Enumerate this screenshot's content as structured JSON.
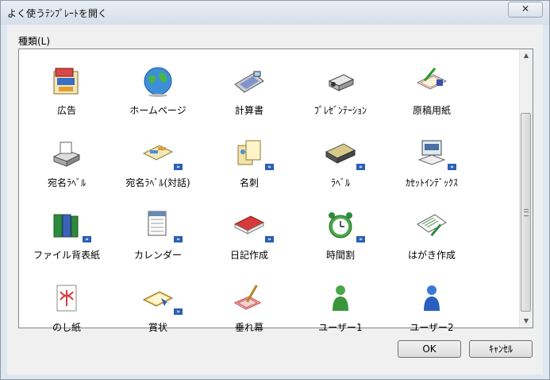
{
  "window": {
    "title": "よく使うﾃﾝﾌﾟﾚｰﾄを開く",
    "close_label": "✕"
  },
  "group": {
    "label": "種類(L)"
  },
  "items": [
    {
      "label": "広告",
      "icon": "sale-sign-icon"
    },
    {
      "label": "ホームページ",
      "icon": "globe-icon"
    },
    {
      "label": "計算書",
      "icon": "calculator-icon"
    },
    {
      "label": "ﾌﾟﾚｾﾞﾝﾃｰｼｮﾝ",
      "icon": "projector-icon"
    },
    {
      "label": "原稿用紙",
      "icon": "manuscript-paper-icon"
    },
    {
      "label": "宛名ﾗﾍﾞﾙ",
      "icon": "printer-label-icon"
    },
    {
      "label": "宛名ﾗﾍﾞﾙ(対話)",
      "icon": "interactive-label-icon"
    },
    {
      "label": "名刺",
      "icon": "business-card-icon"
    },
    {
      "label": "ﾗﾍﾞﾙ",
      "icon": "label-sheet-icon"
    },
    {
      "label": "ｶｾｯﾄｲﾝﾃﾞｯｸｽ",
      "icon": "cassette-index-icon"
    },
    {
      "label": "ファイル背表紙",
      "icon": "file-binder-icon"
    },
    {
      "label": "カレンダー",
      "icon": "calendar-icon"
    },
    {
      "label": "日記作成",
      "icon": "diary-icon"
    },
    {
      "label": "時間割",
      "icon": "alarm-clock-icon"
    },
    {
      "label": "はがき作成",
      "icon": "postcard-icon"
    },
    {
      "label": "のし紙",
      "icon": "noshi-paper-icon"
    },
    {
      "label": "賞状",
      "icon": "certificate-icon"
    },
    {
      "label": "垂れ幕",
      "icon": "banner-icon"
    },
    {
      "label": "ユーザー1",
      "icon": "user-green-icon"
    },
    {
      "label": "ユーザー2",
      "icon": "user-blue-icon"
    }
  ],
  "badge_text": "»",
  "buttons": {
    "ok": "OK",
    "cancel": "ｷｬﾝｾﾙ"
  },
  "scrollbar": {
    "up": "▲",
    "down": "▼"
  }
}
